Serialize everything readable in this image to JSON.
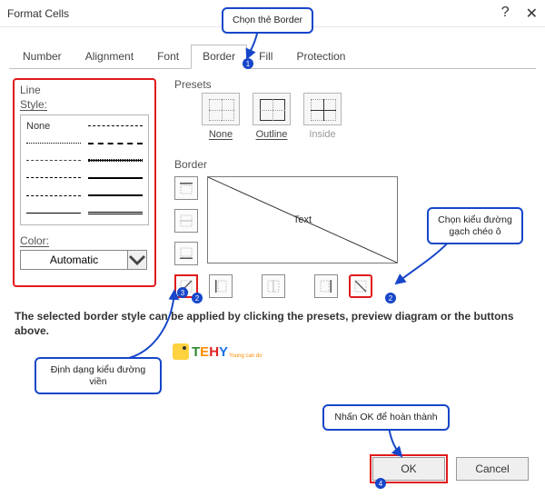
{
  "title": "Format Cells",
  "title_buttons": {
    "help": "?",
    "close": "✕"
  },
  "tabs": {
    "number": "Number",
    "alignment": "Alignment",
    "font": "Font",
    "border": "Border",
    "fill": "Fill",
    "protection": "Protection"
  },
  "line": {
    "header": "Line",
    "style_label": "Style:",
    "none_label": "None",
    "color_label": "Color:",
    "color_value": "Automatic"
  },
  "presets": {
    "header": "Presets",
    "none": "None",
    "outline": "Outline",
    "inside": "Inside"
  },
  "border": {
    "header": "Border",
    "preview_text": "Text"
  },
  "hint": "The selected border style can be applied by clicking the presets, preview diagram or the buttons above.",
  "buttons": {
    "ok": "OK",
    "cancel": "Cancel"
  },
  "callouts": {
    "top": "Chọn thẻ Border",
    "left": "Định dạng kiểu đường viền",
    "right": "Chọn kiểu đường gạch chéo ô",
    "bottom": "Nhấn OK để hoàn thành"
  },
  "badges": {
    "b1": "1",
    "b2": "2",
    "b3": "3",
    "b4": "4"
  },
  "logo": {
    "text": "TEHY",
    "sub": "Young can do"
  }
}
